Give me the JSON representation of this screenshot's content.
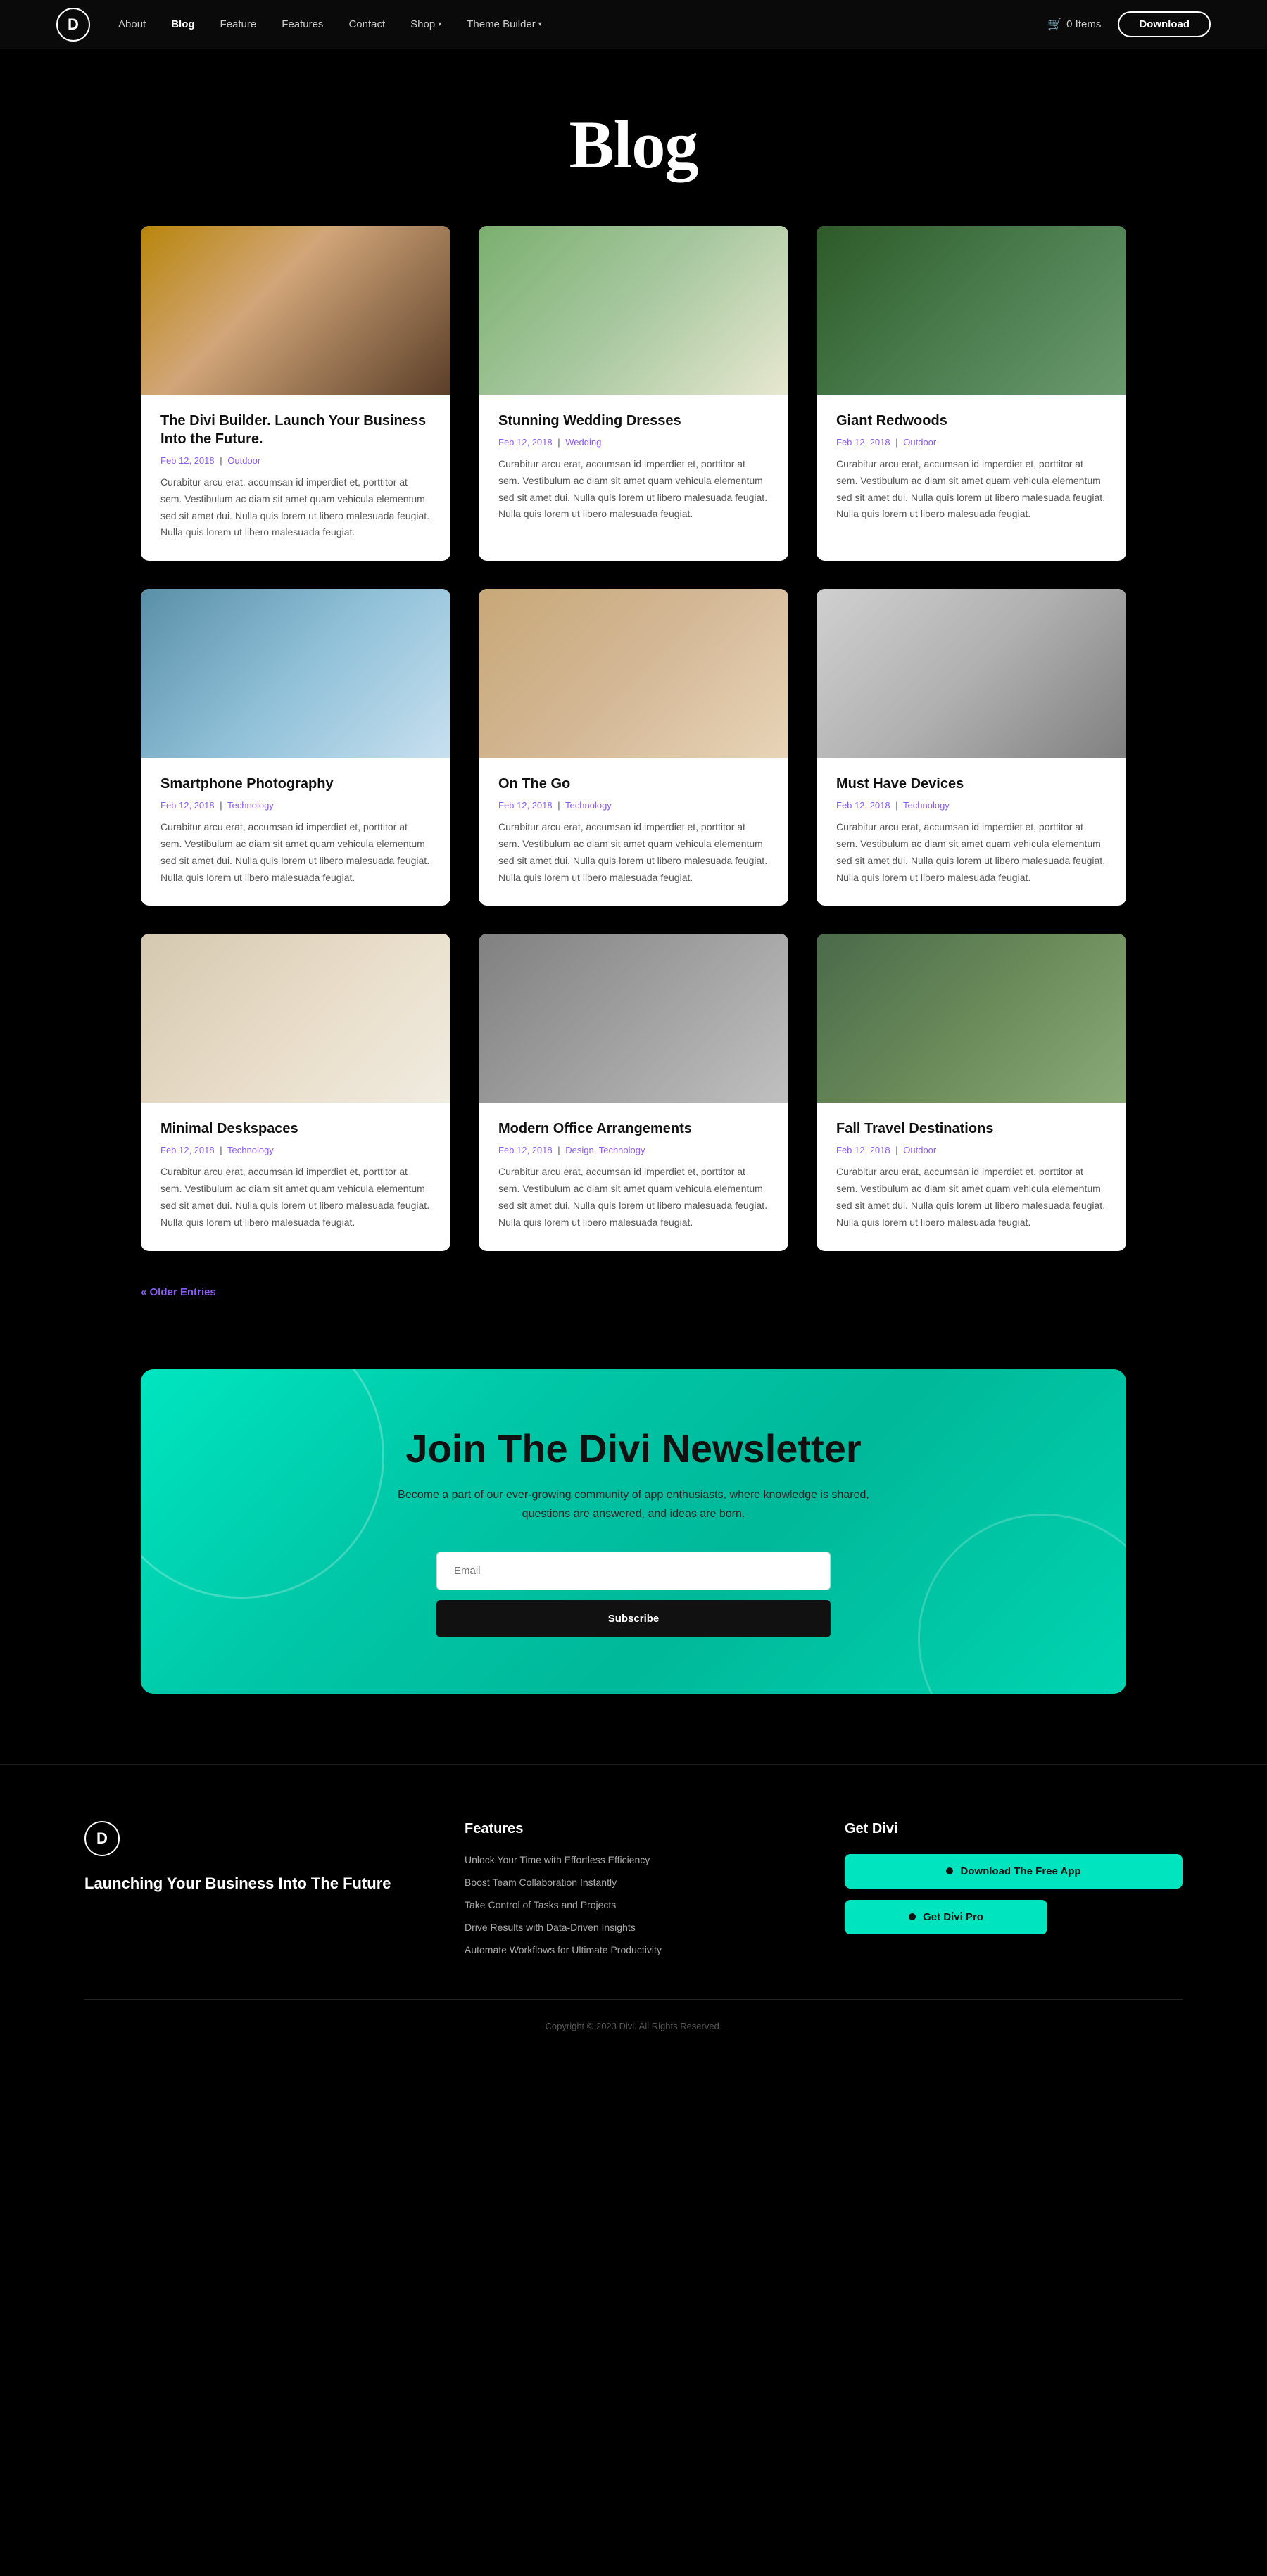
{
  "nav": {
    "logo_letter": "D",
    "links": [
      {
        "label": "About",
        "active": false
      },
      {
        "label": "Blog",
        "active": true
      },
      {
        "label": "Feature",
        "active": false
      },
      {
        "label": "Features",
        "active": false
      },
      {
        "label": "Contact",
        "active": false
      },
      {
        "label": "Shop",
        "active": false,
        "has_dropdown": true
      },
      {
        "label": "Theme Builder",
        "active": false,
        "has_dropdown": true
      }
    ],
    "cart_label": "0 Items",
    "download_label": "Download"
  },
  "hero": {
    "title": "Blog"
  },
  "blog_cards": [
    {
      "title": "The Divi Builder. Launch Your Business Into the Future.",
      "date": "Feb 12, 2018",
      "category": "Outdoor",
      "excerpt": "Curabitur arcu erat, accumsan id imperdiet et, porttitor at sem. Vestibulum ac diam sit amet quam vehicula elementum sed sit amet dui. Nulla quis lorem ut libero malesuada feugiat. Nulla quis lorem ut libero malesuada feugiat.",
      "img_class": "img-divi-builder"
    },
    {
      "title": "Stunning Wedding Dresses",
      "date": "Feb 12, 2018",
      "category": "Wedding",
      "excerpt": "Curabitur arcu erat, accumsan id imperdiet et, porttitor at sem. Vestibulum ac diam sit amet quam vehicula elementum sed sit amet dui. Nulla quis lorem ut libero malesuada feugiat. Nulla quis lorem ut libero malesuada feugiat.",
      "img_class": "img-wedding"
    },
    {
      "title": "Giant Redwoods",
      "date": "Feb 12, 2018",
      "category": "Outdoor",
      "excerpt": "Curabitur arcu erat, accumsan id imperdiet et, porttitor at sem. Vestibulum ac diam sit amet quam vehicula elementum sed sit amet dui. Nulla quis lorem ut libero malesuada feugiat. Nulla quis lorem ut libero malesuada feugiat.",
      "img_class": "img-redwoods"
    },
    {
      "title": "Smartphone Photography",
      "date": "Feb 12, 2018",
      "category": "Technology",
      "excerpt": "Curabitur arcu erat, accumsan id imperdiet et, porttitor at sem. Vestibulum ac diam sit amet quam vehicula elementum sed sit amet dui. Nulla quis lorem ut libero malesuada feugiat. Nulla quis lorem ut libero malesuada feugiat.",
      "img_class": "img-smartphone"
    },
    {
      "title": "On The Go",
      "date": "Feb 12, 2018",
      "category": "Technology",
      "excerpt": "Curabitur arcu erat, accumsan id imperdiet et, porttitor at sem. Vestibulum ac diam sit amet quam vehicula elementum sed sit amet dui. Nulla quis lorem ut libero malesuada feugiat. Nulla quis lorem ut libero malesuada feugiat.",
      "img_class": "img-on-the-go"
    },
    {
      "title": "Must Have Devices",
      "date": "Feb 12, 2018",
      "category": "Technology",
      "excerpt": "Curabitur arcu erat, accumsan id imperdiet et, porttitor at sem. Vestibulum ac diam sit amet quam vehicula elementum sed sit amet dui. Nulla quis lorem ut libero malesuada feugiat. Nulla quis lorem ut libero malesuada feugiat.",
      "img_class": "img-devices"
    },
    {
      "title": "Minimal Deskspaces",
      "date": "Feb 12, 2018",
      "category": "Technology",
      "excerpt": "Curabitur arcu erat, accumsan id imperdiet et, porttitor at sem. Vestibulum ac diam sit amet quam vehicula elementum sed sit amet dui. Nulla quis lorem ut libero malesuada feugiat. Nulla quis lorem ut libero malesuada feugiat.",
      "img_class": "img-desk"
    },
    {
      "title": "Modern Office Arrangements",
      "date": "Feb 12, 2018",
      "category": "Design, Technology",
      "excerpt": "Curabitur arcu erat, accumsan id imperdiet et, porttitor at sem. Vestibulum ac diam sit amet quam vehicula elementum sed sit amet dui. Nulla quis lorem ut libero malesuada feugiat. Nulla quis lorem ut libero malesuada feugiat.",
      "img_class": "img-office"
    },
    {
      "title": "Fall Travel Destinations",
      "date": "Feb 12, 2018",
      "category": "Outdoor",
      "excerpt": "Curabitur arcu erat, accumsan id imperdiet et, porttitor at sem. Vestibulum ac diam sit amet quam vehicula elementum sed sit amet dui. Nulla quis lorem ut libero malesuada feugiat. Nulla quis lorem ut libero malesuada feugiat.",
      "img_class": "img-fall"
    }
  ],
  "older_entries_label": "« Older Entries",
  "newsletter": {
    "title": "Join The Divi Newsletter",
    "description": "Become a part of our ever-growing community of app enthusiasts, where knowledge is shared, questions are answered, and ideas are born.",
    "email_placeholder": "Email",
    "subscribe_label": "Subscribe"
  },
  "footer": {
    "logo_letter": "D",
    "brand_tagline": "Launching Your Business Into The Future",
    "features_title": "Features",
    "features_links": [
      "Unlock Your Time with Effortless Efficiency",
      "Boost Team Collaboration Instantly",
      "Take Control of Tasks and Projects",
      "Drive Results with Data-Driven Insights",
      "Automate Workflows for Ultimate Productivity"
    ],
    "get_divi_title": "Get Divi",
    "download_free_label": "Download The Free App",
    "get_pro_label": "Get Divi Pro",
    "copyright": "Copyright © 2023 Divi. All Rights Reserved."
  }
}
